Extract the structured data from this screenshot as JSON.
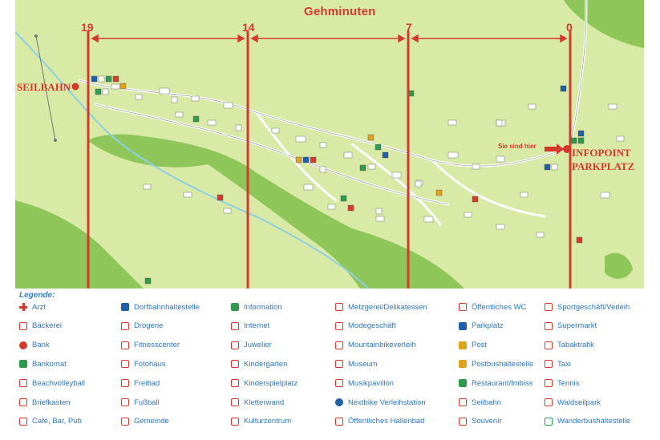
{
  "map": {
    "title": "Gehminuten",
    "minute_markers": [
      "19",
      "14",
      "7",
      "0"
    ],
    "places": {
      "seilbahn": "SEILBAHN",
      "infopoint_line1": "INFOPOINT",
      "infopoint_line2": "PARKPLATZ",
      "you_are_here": "Sie sind hier"
    },
    "colors": {
      "meadow": "#d9e9a6",
      "forest": "#8ec65a",
      "river": "#8fd0e0",
      "accent_red": "#d33a2c"
    }
  },
  "legend": {
    "title": "Legende:",
    "columns": [
      [
        {
          "label": "Arzt",
          "icon": "red-cross-icon",
          "color": "#d33a2c"
        },
        {
          "label": "Bäckerei",
          "icon": "bakery-icon",
          "color": "#d33a2c"
        },
        {
          "label": "Bank",
          "icon": "bank-icon",
          "color": "#d33a2c"
        },
        {
          "label": "Bankomat",
          "icon": "atm-icon",
          "color": "#2e9a4c"
        },
        {
          "label": "Beachvolleyball",
          "icon": "beachvolleyball-icon",
          "color": "#d33a2c"
        },
        {
          "label": "Briefkasten",
          "icon": "mailbox-icon",
          "color": "#d33a2c"
        },
        {
          "label": "Café, Bar, Pub",
          "icon": "cafe-icon",
          "color": "#d33a2c"
        }
      ],
      [
        {
          "label": "Dorfbahnhaltestelle",
          "icon": "village-bus-stop-icon",
          "color": "#1f5fa8"
        },
        {
          "label": "Drogerie",
          "icon": "drugstore-icon",
          "color": "#d33a2c"
        },
        {
          "label": "Fitnesscenter",
          "icon": "fitness-icon",
          "color": "#d33a2c"
        },
        {
          "label": "Fotohaus",
          "icon": "photo-icon",
          "color": "#d33a2c"
        },
        {
          "label": "Freibad",
          "icon": "outdoor-pool-icon",
          "color": "#d33a2c"
        },
        {
          "label": "Fußball",
          "icon": "football-icon",
          "color": "#d33a2c"
        },
        {
          "label": "Gemeinde",
          "icon": "municipality-icon",
          "color": "#d33a2c"
        }
      ],
      [
        {
          "label": "Information",
          "icon": "information-icon",
          "color": "#2e9a4c"
        },
        {
          "label": "Internet",
          "icon": "internet-icon",
          "color": "#d33a2c"
        },
        {
          "label": "Juwelier",
          "icon": "jeweler-icon",
          "color": "#d33a2c"
        },
        {
          "label": "Kindergarten",
          "icon": "kindergarten-icon",
          "color": "#d33a2c"
        },
        {
          "label": "Kinderspielplatz",
          "icon": "playground-icon",
          "color": "#d33a2c"
        },
        {
          "label": "Kletterwand",
          "icon": "climbing-wall-icon",
          "color": "#d33a2c"
        },
        {
          "label": "Kulturzentrum",
          "icon": "culture-center-icon",
          "color": "#d33a2c"
        }
      ],
      [
        {
          "label": "Metzgerei/Delikatessen",
          "icon": "butcher-icon",
          "color": "#d33a2c"
        },
        {
          "label": "Modegeschäft",
          "icon": "fashion-icon",
          "color": "#d33a2c"
        },
        {
          "label": "Mountainbikeverleih",
          "icon": "mountainbike-icon",
          "color": "#d33a2c"
        },
        {
          "label": "Museum",
          "icon": "museum-icon",
          "color": "#d33a2c"
        },
        {
          "label": "Musikpavillon",
          "icon": "music-pavilion-icon",
          "color": "#d33a2c"
        },
        {
          "label": "Nextbike Verleihstation",
          "icon": "nextbike-icon",
          "color": "#1f5fa8"
        },
        {
          "label": "Öffentliches Hallenbad",
          "icon": "indoor-pool-icon",
          "color": "#d33a2c"
        }
      ],
      [
        {
          "label": "Öffentliches WC",
          "icon": "wc-icon",
          "color": "#d33a2c"
        },
        {
          "label": "Parkplatz",
          "icon": "parking-icon",
          "color": "#1f5fa8"
        },
        {
          "label": "Post",
          "icon": "post-icon",
          "color": "#e0a21a"
        },
        {
          "label": "Postbushaltestelle",
          "icon": "postbus-stop-icon",
          "color": "#e0a21a"
        },
        {
          "label": "Restaurant/Imbiss",
          "icon": "restaurant-icon",
          "color": "#2e9a4c"
        },
        {
          "label": "Seilbahn",
          "icon": "cable-car-icon",
          "color": "#d33a2c"
        },
        {
          "label": "Souvenir",
          "icon": "souvenir-icon",
          "color": "#d33a2c"
        }
      ],
      [
        {
          "label": "Sportgeschäft/Verleih",
          "icon": "sports-shop-icon",
          "color": "#d33a2c"
        },
        {
          "label": "Supermarkt",
          "icon": "supermarket-icon",
          "color": "#d33a2c"
        },
        {
          "label": "Tabaktrafik",
          "icon": "tobacco-icon",
          "color": "#d33a2c"
        },
        {
          "label": "Taxi",
          "icon": "taxi-icon",
          "color": "#d33a2c"
        },
        {
          "label": "Tennis",
          "icon": "tennis-icon",
          "color": "#d33a2c"
        },
        {
          "label": "Waldseilpark",
          "icon": "forest-rope-park-icon",
          "color": "#d33a2c"
        },
        {
          "label": "Wanderbushaltestelle",
          "icon": "hiking-bus-stop-icon",
          "color": "#2e9a4c"
        }
      ]
    ]
  }
}
